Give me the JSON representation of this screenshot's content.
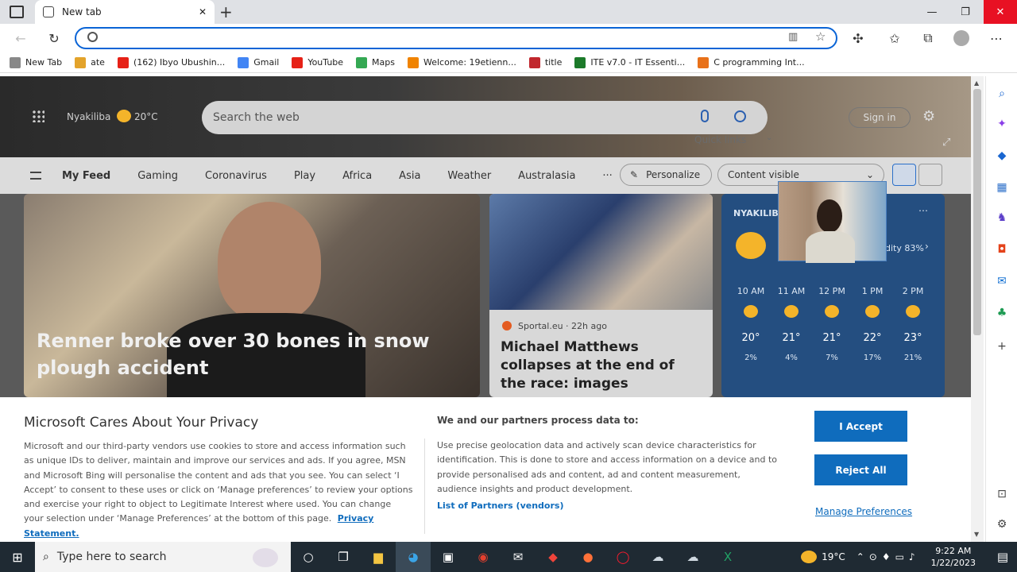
{
  "browser": {
    "tab_title": "New tab",
    "tab_close": "✕",
    "new_tab": "+",
    "bookmarks": [
      {
        "label": "New Tab",
        "color": "#888"
      },
      {
        "label": "ate",
        "color": "#e3a32b"
      },
      {
        "label": "(162) Ibyo Ubushin...",
        "color": "#e62117"
      },
      {
        "label": "Gmail",
        "color": "#4285f4"
      },
      {
        "label": "YouTube",
        "color": "#e62117"
      },
      {
        "label": "Maps",
        "color": "#34a853"
      },
      {
        "label": "Welcome: 19etienn...",
        "color": "#f08300"
      },
      {
        "label": "title",
        "color": "#c1272d"
      },
      {
        "label": "ITE v7.0 - IT Essenti...",
        "color": "#1c7a2a"
      },
      {
        "label": "C programming Int...",
        "color": "#e8711a"
      }
    ]
  },
  "msn": {
    "location": "Nyakiliba",
    "temp": "20°C",
    "search_placeholder": "Search the web",
    "quick_links": "Quick links",
    "sign_in": "Sign in",
    "feed_tabs": [
      "My Feed",
      "Gaming",
      "Coronavirus",
      "Play",
      "Africa",
      "Asia",
      "Weather",
      "Australasia"
    ],
    "more": "···",
    "personalize": "Personalize",
    "content_visible": "Content visible",
    "hero_headline": "Renner broke over 30 bones in snow plough accident",
    "story": {
      "source": "Sportal.eu · 22h ago",
      "headline": "Michael Matthews collapses at the end of the race: images"
    },
    "weather": {
      "location": "NYAKILIBA",
      "humidity": "dity 83%",
      "hours": [
        {
          "time": "10 AM",
          "temp": "20°",
          "rain": "2%"
        },
        {
          "time": "11 AM",
          "temp": "21°",
          "rain": "4%"
        },
        {
          "time": "12 PM",
          "temp": "21°",
          "rain": "7%"
        },
        {
          "time": "1 PM",
          "temp": "22°",
          "rain": "17%"
        },
        {
          "time": "2 PM",
          "temp": "23°",
          "rain": "21%"
        }
      ]
    }
  },
  "privacy": {
    "title": "Microsoft Cares About Your Privacy",
    "body": "Microsoft and our third-party vendors use cookies to store and access information such as unique IDs to deliver, maintain and improve our services and ads. If you agree, MSN and Microsoft Bing will personalise the content and ads that you see. You can select ‘I Accept’ to consent to these uses or click on ‘Manage preferences’ to review your options and exercise your right to object to Legitimate Interest where used. You can change your selection under ‘Manage Preferences’ at the bottom of this page.",
    "privacy_link": "Privacy Statement.",
    "partners_title": "We and our partners process data to:",
    "partners_body": "Use precise geolocation data and actively scan device characteristics for identification. This is done to store and access information on a device and to provide personalised ads and content, ad and content measurement, audience insights and product development.",
    "partners_link": "List of Partners (vendors)",
    "accept": "I Accept",
    "reject": "Reject All",
    "manage": "Manage Preferences"
  },
  "taskbar": {
    "search_placeholder": "Type here to search",
    "weather_temp": "19°C",
    "time": "9:22 AM",
    "date": "1/22/2023"
  }
}
